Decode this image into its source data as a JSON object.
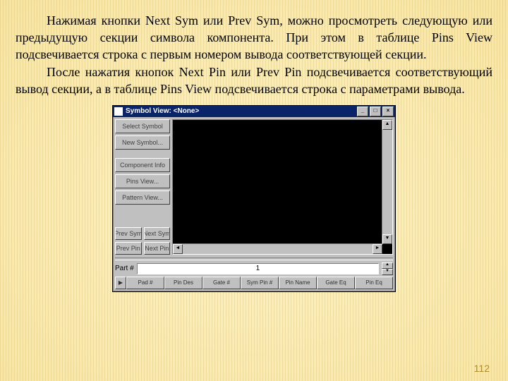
{
  "paragraph1": "Нажимая кнопки Next Sym или Prev Sym, можно просмотреть следующую или предыдущую секции символа компонента. При этом в таблице Pins View подсвечивается строка с первым номером вывода соответствующей секции.",
  "paragraph2": "После нажатия кнопок Next Pin или Prev Pin подсвечивается соответствующий вывод секции, а в таблице Pins View подсвечивается строка с параметрами вывода.",
  "page_number": "112",
  "window": {
    "title": "Symbol View: <None>",
    "side_buttons": {
      "select_symbol": "Select Symbol",
      "new_symbol": "New Symbol...",
      "component_info": "Component Info",
      "pins_view": "Pins View...",
      "pattern_view": "Pattern View..."
    },
    "nav": {
      "prev_sym": "Prev Sym",
      "next_sym": "Next Sym",
      "prev_pin": "Prev Pin",
      "next_pin": "Next Pin"
    },
    "part_label": "Part #",
    "part_value": "1",
    "columns": {
      "c1": "Pad #",
      "c2": "Pin Des",
      "c3": "Gate #",
      "c4": "Sym Pin #",
      "c5": "Pin Name",
      "c6": "Gate Eq",
      "c7": "Pin Eq"
    }
  }
}
